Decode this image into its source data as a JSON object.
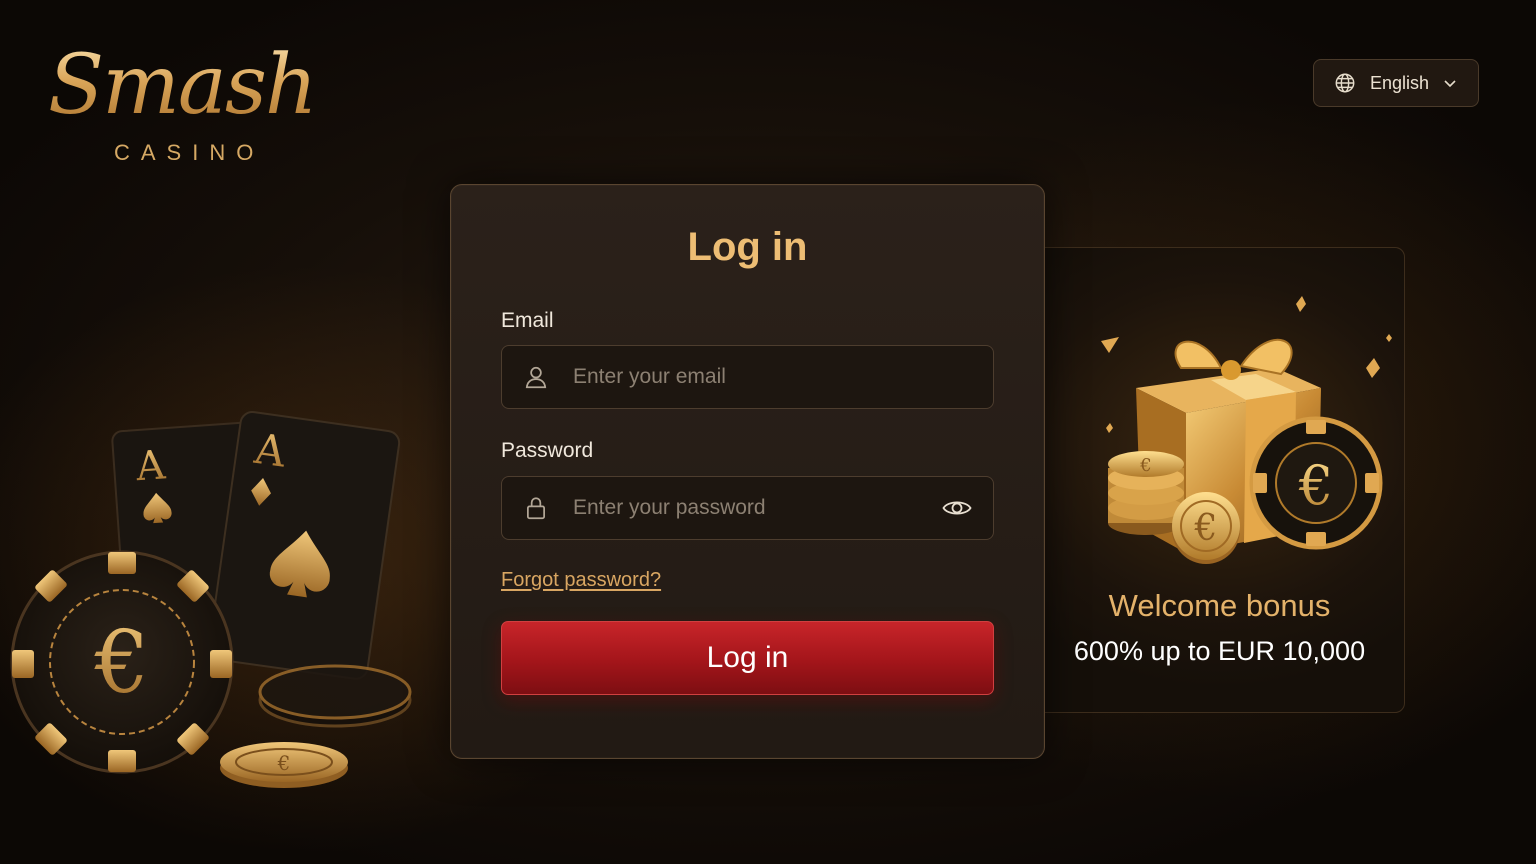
{
  "brand": {
    "name": "Smash",
    "subtitle": "CASINO"
  },
  "language": {
    "selected": "English",
    "icon": "globe-icon",
    "dropdown_icon": "chevron-down-icon"
  },
  "login": {
    "title": "Log in",
    "email_label": "Email",
    "email_placeholder": "Enter your email",
    "email_value": "",
    "password_label": "Password",
    "password_placeholder": "Enter your password",
    "password_value": "",
    "forgot_link": "Forgot password?",
    "submit_label": "Log in"
  },
  "bonus": {
    "title": "Welcome bonus",
    "offer": "600% up to EUR 10,000"
  },
  "colors": {
    "gold": "#e4b26a",
    "button_red": "#b01c21",
    "background": "#160f09"
  }
}
